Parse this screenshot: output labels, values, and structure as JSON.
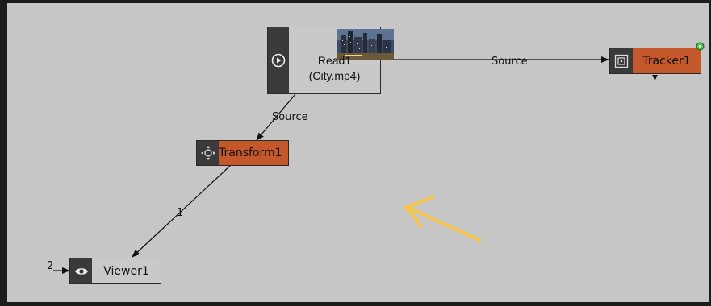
{
  "nodes": {
    "read": {
      "name": "Read1",
      "file": "(City.mp4)"
    },
    "transform": {
      "name": "Transform1"
    },
    "tracker": {
      "name": "Tracker1"
    },
    "viewer": {
      "name": "Viewer1"
    }
  },
  "links": {
    "read_to_tracker": "Source",
    "read_to_transform": "Source",
    "transform_to_viewer": "1",
    "viewer_input": "2"
  },
  "colors": {
    "canvas": "#c6c6c6",
    "node_orange": "#c4582a",
    "node_gray": "#c9c9c9",
    "node_side": "#3a3a3a",
    "annotation_arrow": "#f7c64a"
  },
  "icons": {
    "read": "play-circle-icon",
    "transform": "move-arrows-icon",
    "tracker": "tracker-target-icon",
    "viewer": "eye-icon",
    "annotation": "hand-drawn-arrow-icon"
  }
}
